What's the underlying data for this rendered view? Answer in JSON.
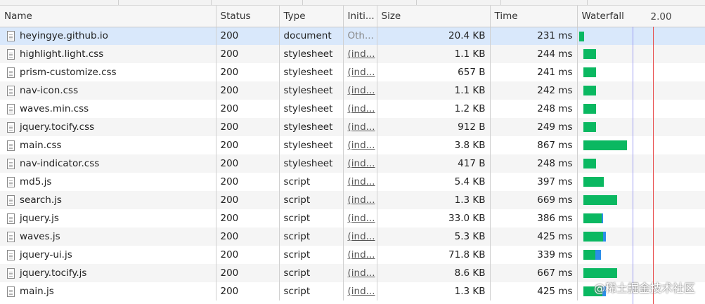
{
  "columns": {
    "name": "Name",
    "status": "Status",
    "type": "Type",
    "initiator": "Initi...",
    "size": "Size",
    "time": "Time",
    "waterfall": "Waterfall",
    "waterfall_tick": "2.00"
  },
  "rows": [
    {
      "name": "heyingye.github.io",
      "status": "200",
      "type": "document",
      "initiator": "Oth...",
      "size": "20.4 KB",
      "time": "231 ms"
    },
    {
      "name": "highlight.light.css",
      "status": "200",
      "type": "stylesheet",
      "initiator": "(ind...",
      "size": "1.1 KB",
      "time": "244 ms"
    },
    {
      "name": "prism-customize.css",
      "status": "200",
      "type": "stylesheet",
      "initiator": "(ind...",
      "size": "657 B",
      "time": "241 ms"
    },
    {
      "name": "nav-icon.css",
      "status": "200",
      "type": "stylesheet",
      "initiator": "(ind...",
      "size": "1.1 KB",
      "time": "242 ms"
    },
    {
      "name": "waves.min.css",
      "status": "200",
      "type": "stylesheet",
      "initiator": "(ind...",
      "size": "1.2 KB",
      "time": "248 ms"
    },
    {
      "name": "jquery.tocify.css",
      "status": "200",
      "type": "stylesheet",
      "initiator": "(ind...",
      "size": "912 B",
      "time": "249 ms"
    },
    {
      "name": "main.css",
      "status": "200",
      "type": "stylesheet",
      "initiator": "(ind...",
      "size": "3.8 KB",
      "time": "867 ms"
    },
    {
      "name": "nav-indicator.css",
      "status": "200",
      "type": "stylesheet",
      "initiator": "(ind...",
      "size": "417 B",
      "time": "248 ms"
    },
    {
      "name": "md5.js",
      "status": "200",
      "type": "script",
      "initiator": "(ind...",
      "size": "5.4 KB",
      "time": "397 ms"
    },
    {
      "name": "search.js",
      "status": "200",
      "type": "script",
      "initiator": "(ind...",
      "size": "1.3 KB",
      "time": "669 ms"
    },
    {
      "name": "jquery.js",
      "status": "200",
      "type": "script",
      "initiator": "(ind...",
      "size": "33.0 KB",
      "time": "386 ms"
    },
    {
      "name": "waves.js",
      "status": "200",
      "type": "script",
      "initiator": "(ind...",
      "size": "5.3 KB",
      "time": "425 ms"
    },
    {
      "name": "jquery-ui.js",
      "status": "200",
      "type": "script",
      "initiator": "(ind...",
      "size": "71.8 KB",
      "time": "339 ms"
    },
    {
      "name": "jquery.tocify.js",
      "status": "200",
      "type": "script",
      "initiator": "(ind...",
      "size": "8.6 KB",
      "time": "667 ms"
    },
    {
      "name": "main.js",
      "status": "200",
      "type": "script",
      "initiator": "(ind...",
      "size": "1.3 KB",
      "time": "425 ms"
    }
  ],
  "colors": {
    "wait": "#0ab861",
    "receive": "#2c8ee9",
    "dom_content_loaded_line": "#9b9bf0",
    "load_line": "#e84b4b",
    "selected_row": "#d9e8fb"
  },
  "watermark": "@稀土掘金技术社区"
}
